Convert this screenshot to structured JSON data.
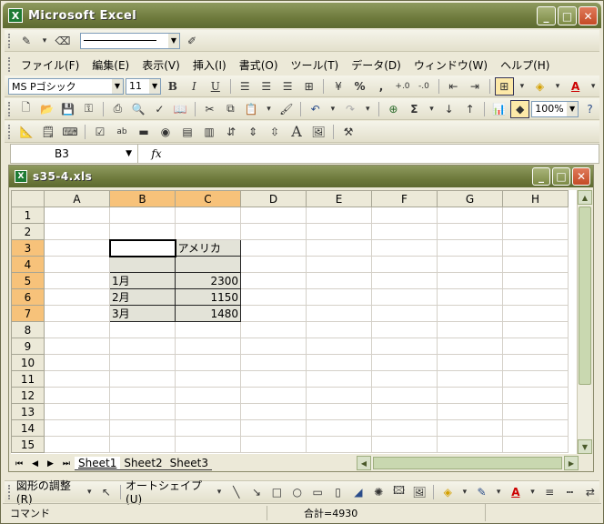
{
  "app": {
    "title": "Microsoft Excel"
  },
  "menu": [
    "ファイル(F)",
    "編集(E)",
    "表示(V)",
    "挿入(I)",
    "書式(O)",
    "ツール(T)",
    "データ(D)",
    "ウィンドウ(W)",
    "ヘルプ(H)"
  ],
  "format": {
    "font": "MS Pゴシック",
    "size": "11",
    "bold": "B",
    "italic": "I",
    "underline": "U",
    "percent": "%",
    "comma": ",",
    "inc_decimal": "+.0",
    "dec_decimal": "-.0",
    "font_color_letter": "A"
  },
  "standard": {
    "sum": "Σ",
    "zoom": "100%"
  },
  "forms": {
    "label_letter": "A"
  },
  "formula": {
    "name_box": "B3",
    "fx": "fx",
    "content": ""
  },
  "doc": {
    "title": "s35-4.xls"
  },
  "columns": [
    "A",
    "B",
    "C",
    "D",
    "E",
    "F",
    "G",
    "H"
  ],
  "rows": [
    "1",
    "2",
    "3",
    "4",
    "5",
    "6",
    "7",
    "8",
    "9",
    "10",
    "11",
    "12",
    "13",
    "14",
    "15"
  ],
  "cells": {
    "C3": "アメリカ",
    "B5": "1月",
    "C5": "2300",
    "B6": "2月",
    "C6": "1150",
    "B7": "3月",
    "C7": "1480"
  },
  "sheets": [
    "Sheet1",
    "Sheet2",
    "Sheet3"
  ],
  "drawing": {
    "adjust": "図形の調整(R)",
    "autoshape": "オートシェイプ(U)",
    "text_color_letter": "A"
  },
  "status": {
    "mode": "コマンド",
    "sum": "合計=4930"
  }
}
